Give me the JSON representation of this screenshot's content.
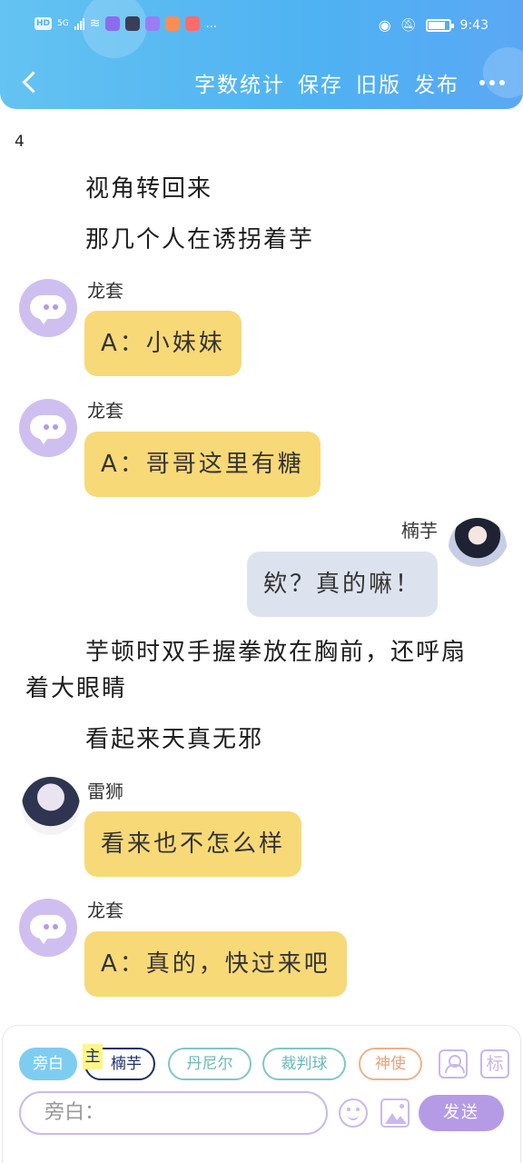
{
  "status_bar": {
    "network": "HD",
    "signal": "5G",
    "time": "9:43",
    "more": "..."
  },
  "header": {
    "actions": {
      "word_count": "字数统计",
      "save": "保存",
      "old_version": "旧版",
      "publish": "发布"
    }
  },
  "content": {
    "page_number": "4",
    "items": [
      {
        "type": "narration",
        "text": "视角转回来"
      },
      {
        "type": "narration",
        "text": "那几个人在诱拐着芋"
      },
      {
        "type": "message",
        "speaker": "龙套",
        "text": "A：小妹妹"
      },
      {
        "type": "message",
        "speaker": "龙套",
        "text": "A：哥哥这里有糖"
      },
      {
        "type": "message",
        "speaker": "楠芋",
        "text": "欸？真的嘛！"
      },
      {
        "type": "narration",
        "text": "芋顿时双手握拳放在胸前，还呼扇"
      },
      {
        "type": "narration",
        "text": "着大眼睛"
      },
      {
        "type": "narration",
        "text": "看起来天真无邪"
      },
      {
        "type": "message",
        "speaker": "雷狮",
        "text": "看来也不怎么样"
      },
      {
        "type": "message",
        "speaker": "龙套",
        "text": "A：真的，快过来吧"
      }
    ]
  },
  "toolbar": {
    "roles": [
      "旁白",
      "楠芋",
      "丹尼尔",
      "裁判球",
      "神使"
    ],
    "main_tag": "主",
    "mark_label": "标",
    "input_placeholder": "旁白：",
    "send_label": "发送"
  },
  "colors": {
    "header": "#57b8f2",
    "bubble_left": "#f8d977",
    "bubble_right": "#dde3ee",
    "accent": "#b59be6"
  }
}
